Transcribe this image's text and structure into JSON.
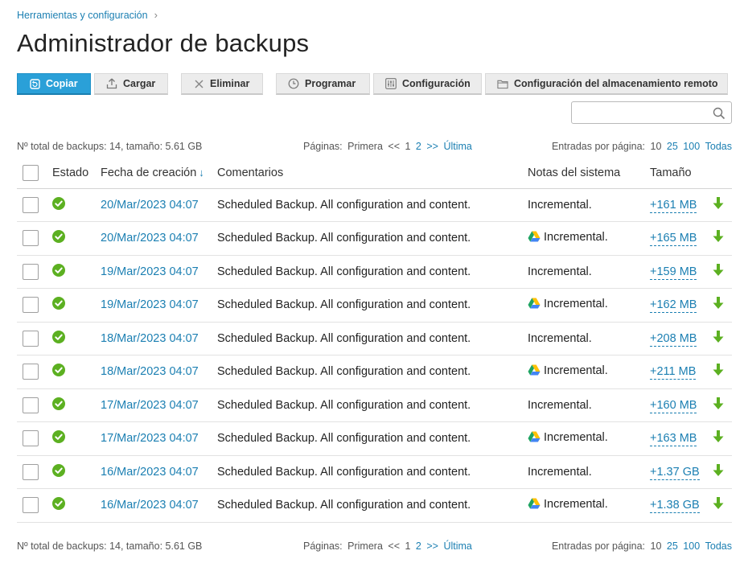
{
  "breadcrumb": {
    "label": "Herramientas y configuración",
    "chevron": "›"
  },
  "page_title": "Administrador de backups",
  "toolbar": {
    "copy": "Copiar",
    "upload": "Cargar",
    "delete": "Eliminar",
    "schedule": "Programar",
    "settings": "Configuración",
    "remote_storage": "Configuración del almacenamiento remoto"
  },
  "search": {
    "value": "",
    "placeholder": ""
  },
  "summary": {
    "total": "Nº total de backups: 14, tamaño: 5.61 GB",
    "pages_label": "Páginas:",
    "first": "Primera",
    "prev": "<<",
    "page1": "1",
    "page2": "2",
    "next": ">>",
    "last": "Última",
    "per_page_label": "Entradas por página:",
    "pp10": "10",
    "pp25": "25",
    "pp100": "100",
    "pp_all": "Todas"
  },
  "columns": {
    "status": "Estado",
    "date": "Fecha de creación",
    "sort_arrow": "↓",
    "comments": "Comentarios",
    "notes": "Notas del sistema",
    "size": "Tamaño"
  },
  "rows": [
    {
      "date": "20/Mar/2023 04:07",
      "comment": "Scheduled Backup. All configuration and content.",
      "notes": "Incremental.",
      "drive": false,
      "size": "+161 MB"
    },
    {
      "date": "20/Mar/2023 04:07",
      "comment": "Scheduled Backup. All configuration and content.",
      "notes": "Incremental.",
      "drive": true,
      "size": "+165 MB"
    },
    {
      "date": "19/Mar/2023 04:07",
      "comment": "Scheduled Backup. All configuration and content.",
      "notes": "Incremental.",
      "drive": false,
      "size": "+159 MB"
    },
    {
      "date": "19/Mar/2023 04:07",
      "comment": "Scheduled Backup. All configuration and content.",
      "notes": "Incremental.",
      "drive": true,
      "size": "+162 MB"
    },
    {
      "date": "18/Mar/2023 04:07",
      "comment": "Scheduled Backup. All configuration and content.",
      "notes": "Incremental.",
      "drive": false,
      "size": "+208 MB"
    },
    {
      "date": "18/Mar/2023 04:07",
      "comment": "Scheduled Backup. All configuration and content.",
      "notes": "Incremental.",
      "drive": true,
      "size": "+211 MB"
    },
    {
      "date": "17/Mar/2023 04:07",
      "comment": "Scheduled Backup. All configuration and content.",
      "notes": "Incremental.",
      "drive": false,
      "size": "+160 MB"
    },
    {
      "date": "17/Mar/2023 04:07",
      "comment": "Scheduled Backup. All configuration and content.",
      "notes": "Incremental.",
      "drive": true,
      "size": "+163 MB"
    },
    {
      "date": "16/Mar/2023 04:07",
      "comment": "Scheduled Backup. All configuration and content.",
      "notes": "Incremental.",
      "drive": false,
      "size": "+1.37 GB"
    },
    {
      "date": "16/Mar/2023 04:07",
      "comment": "Scheduled Backup. All configuration and content.",
      "notes": "Incremental.",
      "drive": true,
      "size": "+1.38 GB"
    }
  ],
  "colors": {
    "link": "#1b7fb2",
    "primary_button": "#2aa0d8",
    "status_ok": "#5cb021",
    "download": "#5cb021"
  },
  "icons": {
    "status": "check-circle-icon",
    "download": "download-arrow-icon",
    "remote": "google-drive-icon",
    "search": "search-icon"
  }
}
